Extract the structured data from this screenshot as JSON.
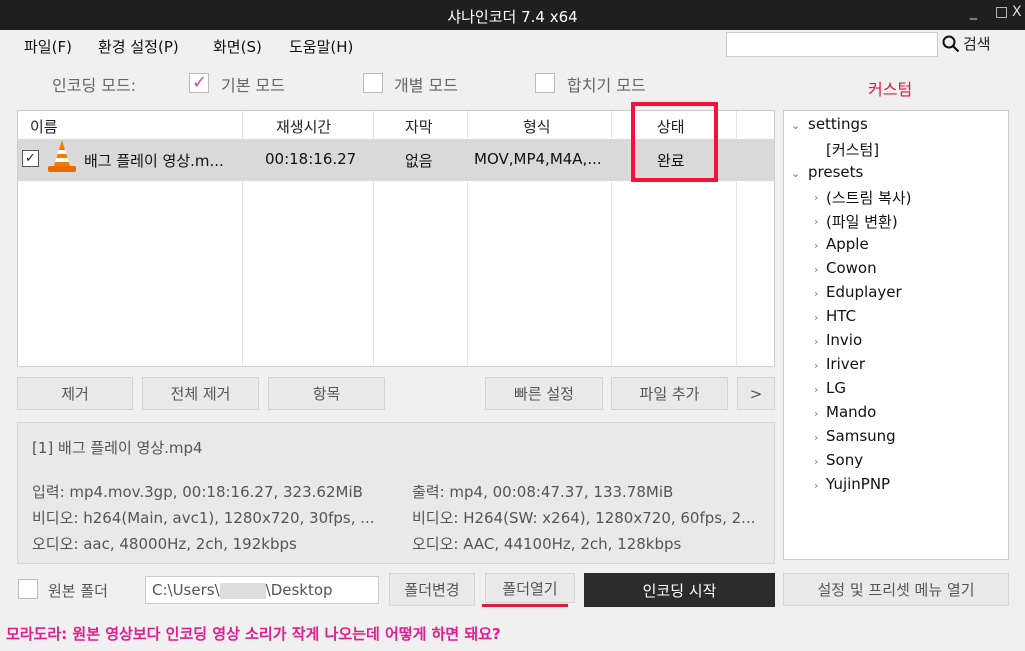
{
  "window": {
    "title": "샤나인코더  7.4 x64",
    "min": "_",
    "max": "□",
    "close": "X"
  },
  "menu": {
    "items": [
      "파일(F)",
      "환경 설정(P)",
      "화면(S)",
      "도움말(H)"
    ],
    "search_label": "검색",
    "search_value": ""
  },
  "modes": {
    "label": "인코딩 모드:",
    "basic": "기본 모드",
    "individual": "개별 모드",
    "merge": "합치기 모드",
    "custom": "커스텀"
  },
  "table": {
    "headers": [
      "이름",
      "재생시간",
      "자막",
      "형식",
      "상태"
    ],
    "rows": [
      {
        "name": "배그 플레이 영상.m...",
        "duration": "00:18:16.27",
        "subtitle": "없음",
        "format": "MOV,MP4,M4A,...",
        "status": "완료"
      }
    ]
  },
  "buttons": {
    "remove": "제거",
    "remove_all": "전체 제거",
    "item": "항목",
    "quick_settings": "빠른 설정",
    "add_file": "파일 추가",
    "more": ">"
  },
  "info": {
    "title": "[1] 배그 플레이 영상.mp4",
    "input": "입력: mp4.mov.3gp, 00:18:16.27, 323.62MiB",
    "input_video": "비디오: h264(Main, avc1), 1280x720, 30fps, ...",
    "input_audio": "오디오: aac, 48000Hz, 2ch, 192kbps",
    "output": "출력: mp4, 00:08:47.37, 133.78MiB",
    "output_video": "비디오: H264(SW: x264), 1280x720, 60fps, 2...",
    "output_audio": "오디오: AAC, 44100Hz, 2ch, 128kbps"
  },
  "tree": {
    "settings": "settings",
    "settings_child": "[커스텀]",
    "presets": "presets",
    "preset_items": [
      "(스트림 복사)",
      "(파일 변환)",
      "Apple",
      "Cowon",
      "Eduplayer",
      "HTC",
      "Invio",
      "Iriver",
      "LG",
      "Mando",
      "Samsung",
      "Sony",
      "YujinPNP"
    ]
  },
  "bottom": {
    "original_folder": "원본 폴더",
    "path_prefix": "C:\\Users\\",
    "path_suffix": "\\Desktop",
    "change_folder": "폴더변경",
    "open_folder": "폴더열기",
    "start_encoding": "인코딩 시작",
    "open_settings_menu": "설정 및 프리셋 메뉴 열기"
  },
  "footer": {
    "question": "모라도라: 원본 영상보다 인코딩 영상 소리가 작게 나오는데 어떻게 하면 돼요?"
  },
  "colors": {
    "accent_red": "#e4193b",
    "footer_pink": "#e01e8c",
    "check_pink": "#e04aa0"
  }
}
